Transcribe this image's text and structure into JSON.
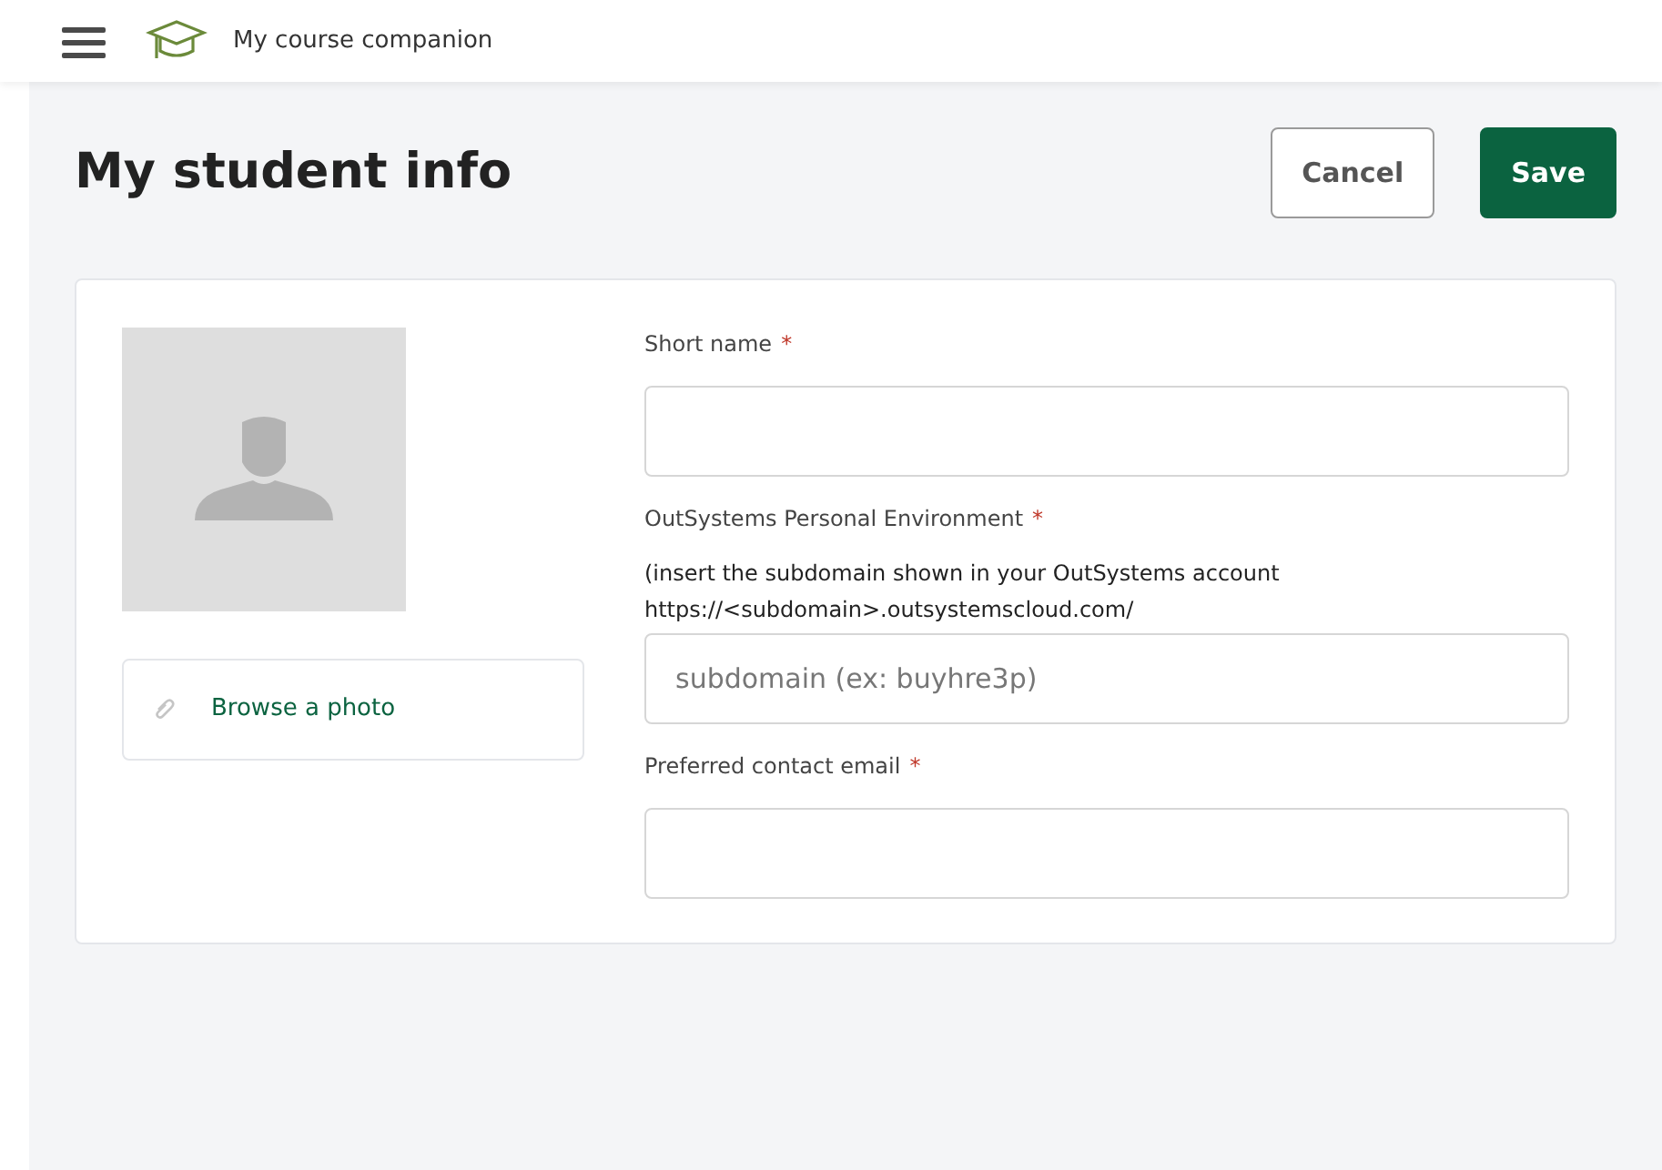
{
  "header": {
    "app_title": "My course companion"
  },
  "page": {
    "title": "My student info"
  },
  "actions": [
    {
      "label": "Cancel",
      "kind": "secondary"
    },
    {
      "label": "Save",
      "kind": "primary"
    }
  ],
  "photo": {
    "browse_label": "Browse a photo"
  },
  "fields": [
    {
      "label": "Short name",
      "required_mark": "*"
    },
    {
      "label": "OutSystems Personal Environment",
      "required_mark": "*",
      "hint": "(insert the subdomain shown in your OutSystems account https://<subdomain>.outsystemscloud.com/",
      "placeholder": "subdomain (ex: buyhre3p)"
    },
    {
      "label": "Preferred contact email",
      "required_mark": "*"
    }
  ]
}
